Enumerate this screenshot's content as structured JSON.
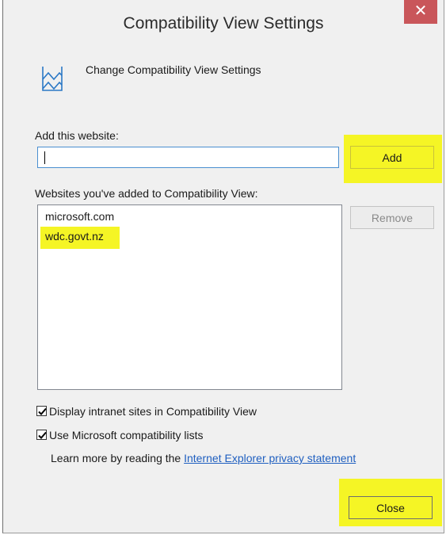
{
  "window": {
    "title": "Compatibility View Settings",
    "close_glyph": "✕"
  },
  "header": {
    "icon": "compatibility-view-icon",
    "text": "Change Compatibility View Settings"
  },
  "add_site": {
    "label": "Add this website:",
    "value": "",
    "button_label": "Add"
  },
  "sites": {
    "label": "Websites you've added to Compatibility View:",
    "items": [
      "microsoft.com",
      "wdc.govt.nz"
    ],
    "remove_label": "Remove"
  },
  "options": {
    "intranet": {
      "label": "Display intranet sites in Compatibility View",
      "checked": true
    },
    "ms_lists": {
      "label": "Use Microsoft compatibility lists",
      "checked": true
    }
  },
  "learn_more": {
    "prefix": "Learn more by reading the ",
    "link_text": "Internet Explorer privacy statement"
  },
  "footer": {
    "close_label": "Close"
  },
  "colors": {
    "highlight": "#f5f525",
    "link": "#1f5fc0",
    "title_close_bg": "#c9565a"
  }
}
